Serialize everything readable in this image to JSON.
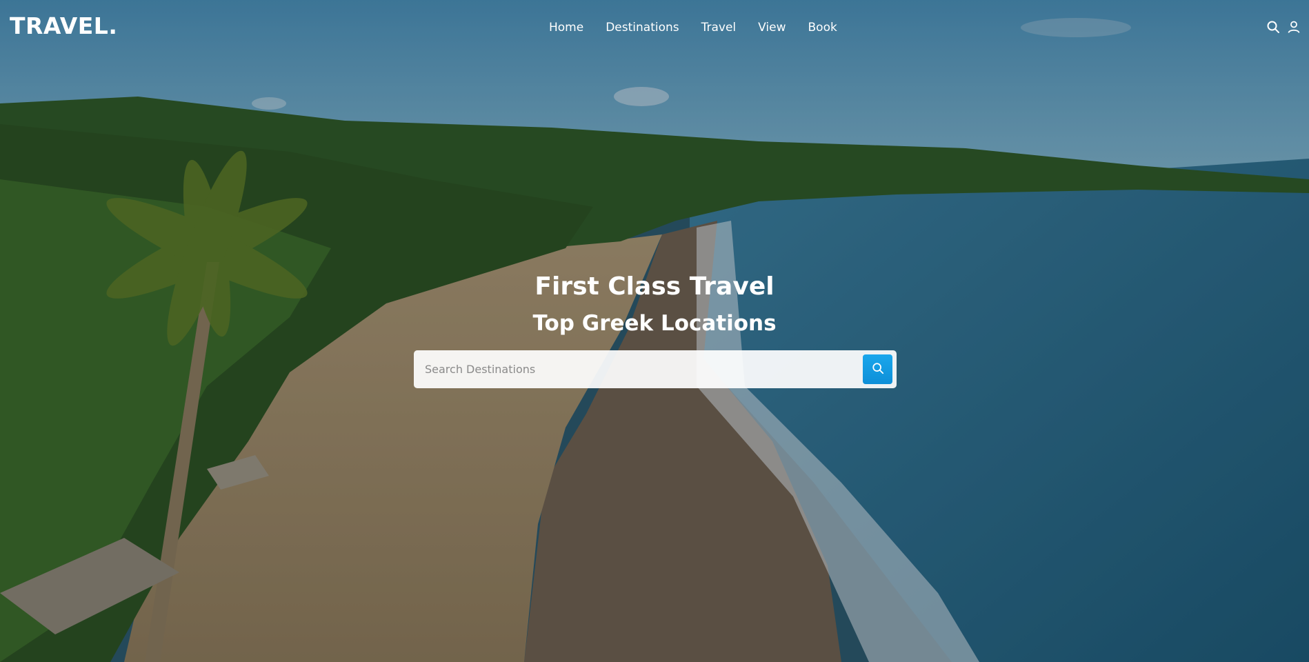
{
  "nav": {
    "logo": "TRAVEL.",
    "items": [
      {
        "label": "Home"
      },
      {
        "label": "Destinations"
      },
      {
        "label": "Travel"
      },
      {
        "label": "View"
      },
      {
        "label": "Book"
      }
    ],
    "icons": [
      "search-icon",
      "user-icon"
    ]
  },
  "hero": {
    "title": "First Class Travel",
    "subtitle": "Top Greek Locations",
    "background": "aerial beach photo with palm trees and ocean"
  },
  "search": {
    "placeholder": "Search Destinations",
    "value": "",
    "button_icon": "search-icon"
  },
  "colors": {
    "accent": "#1aa7ec",
    "text": "#ffffff"
  }
}
